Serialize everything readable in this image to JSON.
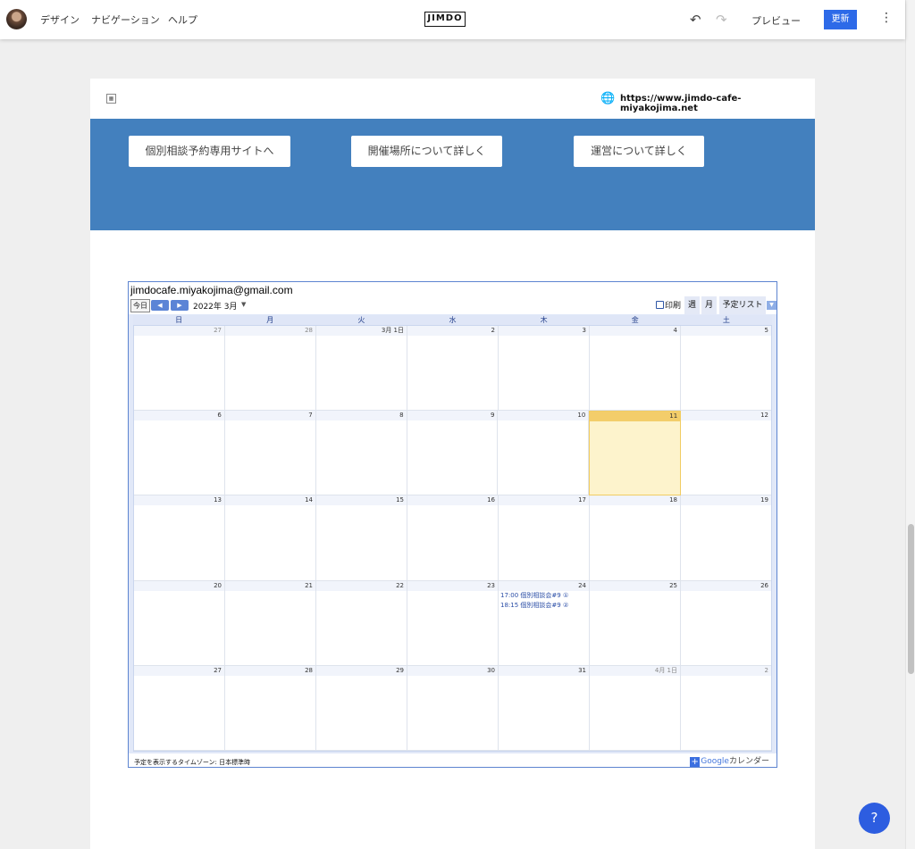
{
  "topbar": {
    "nav": [
      "デザイン",
      "ナビゲーション",
      "ヘルプ"
    ],
    "logo": "JIMDO",
    "undo_icon": "↶",
    "redo_icon": "↷",
    "preview_label": "プレビュー",
    "update_label": "更新",
    "more_icon": "⋮"
  },
  "site": {
    "globe_icon": "🌐",
    "url": "https://www.jimdo-cafe-miyakojima.net",
    "banner_buttons": [
      "個別相談予約専用サイトへ",
      "開催場所について詳しく",
      "運営について詳しく"
    ],
    "banner_color": "#4380be"
  },
  "calendar": {
    "owner": "jimdocafe.miyakojima@gmail.com",
    "today_label": "今日",
    "prev_icon": "◀",
    "next_icon": "▶",
    "month_title": "2022年 3月",
    "print_label": "印刷",
    "view_tabs": [
      "週",
      "月",
      "予定リスト"
    ],
    "weekdays": [
      "日",
      "月",
      "火",
      "水",
      "木",
      "金",
      "土"
    ],
    "weeks": [
      [
        {
          "n": "27",
          "other": true
        },
        {
          "n": "28",
          "other": true
        },
        {
          "n": "3月 1日"
        },
        {
          "n": "2"
        },
        {
          "n": "3"
        },
        {
          "n": "4"
        },
        {
          "n": "5"
        }
      ],
      [
        {
          "n": "6"
        },
        {
          "n": "7"
        },
        {
          "n": "8"
        },
        {
          "n": "9"
        },
        {
          "n": "10"
        },
        {
          "n": "11",
          "today": true
        },
        {
          "n": "12"
        }
      ],
      [
        {
          "n": "13"
        },
        {
          "n": "14"
        },
        {
          "n": "15"
        },
        {
          "n": "16"
        },
        {
          "n": "17"
        },
        {
          "n": "18"
        },
        {
          "n": "19"
        }
      ],
      [
        {
          "n": "20"
        },
        {
          "n": "21"
        },
        {
          "n": "22"
        },
        {
          "n": "23"
        },
        {
          "n": "24",
          "events": [
            "17:00 個別相談会#9 ①",
            "18:15 個別相談会#9 ②"
          ]
        },
        {
          "n": "25"
        },
        {
          "n": "26"
        }
      ],
      [
        {
          "n": "27"
        },
        {
          "n": "28"
        },
        {
          "n": "29"
        },
        {
          "n": "30"
        },
        {
          "n": "31"
        },
        {
          "n": "4月 1日",
          "other": true
        },
        {
          "n": "2",
          "other": true
        }
      ]
    ],
    "timezone_text": "予定を表示するタイムゾーン: 日本標準時",
    "gcal_brand": "Google",
    "gcal_label": "カレンダー"
  },
  "help_label": "?"
}
